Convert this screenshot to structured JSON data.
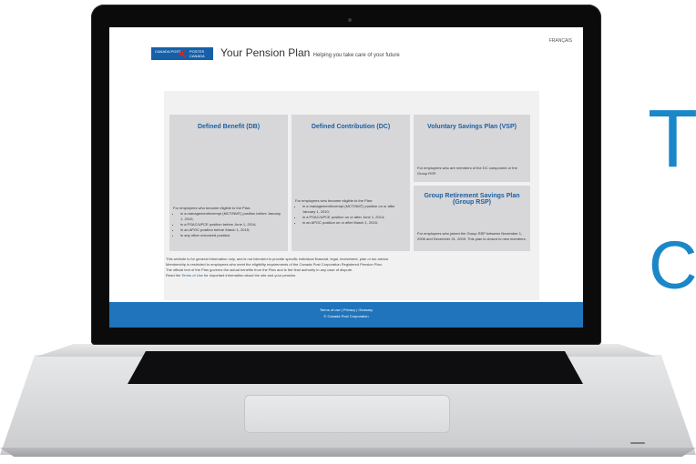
{
  "page": {
    "language_link": "FRANÇAIS",
    "logo": {
      "left_text": "CANADA POST",
      "right_text": "POSTES CANADA"
    },
    "title": "Your Pension Plan",
    "tagline": "Helping you take care of your future"
  },
  "tiles": [
    {
      "title": "Defined Benefit (DB)",
      "intro": "For employees who became eligible to the Plan:",
      "bullets": [
        "in a management/exempt (MCT/NMT) position before January 1, 2010;",
        "in a PSAC/UPCE position before June 1, 2014;",
        "in an APOC position before March 1, 2015;",
        "in any other unionized position."
      ]
    },
    {
      "title": "Defined Contribution (DC)",
      "intro": "For employees who became eligible to the Plan:",
      "bullets": [
        "in a management/exempt (MCT/NMT) position on or after January 1, 2010;",
        "in a PSAC/UPCE position on or after June 1, 2014;",
        "in an APOC position on or after March 1, 2015."
      ]
    },
    {
      "title": "Voluntary Savings Plan (VSP)",
      "intro": "For employees who are members of the DC component or the Group RSP."
    },
    {
      "title": "Group Retirement Savings Plan (Group RSP)",
      "intro": "For employees who joined the Group RSP between November 1, 2006 and December 31, 2009. This plan is closed to new members."
    }
  ],
  "footer": {
    "line1": "This website is for general information only, and is not intended to provide specific individual financial, legal, investment, plan or tax advice.",
    "line2": "Membership is restricted to employees who meet the eligibility requirements of the Canada Post Corporation Registered Pension Plan.",
    "line3": "The official text of the Plan governs the actual benefits from the Plan and is the final authority in any case of dispute.",
    "line4_pre": "Read the",
    "line4_link": "Terms of Use",
    "line4_post": "for important information about the site and your pension."
  },
  "bluebar": {
    "links": "Terms of use  |  Privacy  |  Glossary",
    "copyright": "© Canada Post Corporation"
  },
  "overlay": {
    "letter_top": "T",
    "letter_bottom": "C"
  },
  "colors": {
    "brand_blue": "#1d5fa2",
    "footer_blue": "#1f74bc",
    "overlay_blue": "#1a87c8",
    "tile_gray": "#d7d7d9"
  }
}
